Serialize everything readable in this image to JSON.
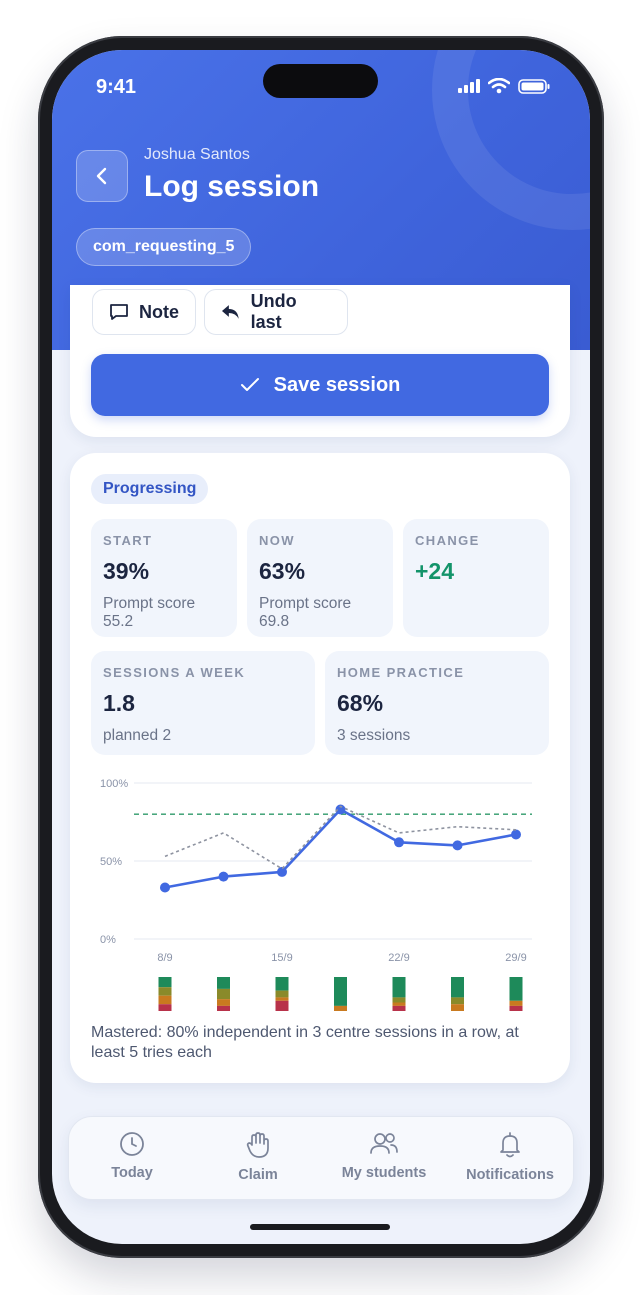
{
  "status_bar": {
    "time": "9:41"
  },
  "header": {
    "student_name": "Joshua Santos",
    "title": "Log session",
    "target_chip": "com_requesting_5"
  },
  "actions": {
    "note_label": "Note",
    "undo_label": "Undo last",
    "save_label": "Save session"
  },
  "progress": {
    "badge": "Progressing",
    "start": {
      "label": "START",
      "value": "39%",
      "sub1": "Prompt score",
      "sub2": "55.2"
    },
    "now": {
      "label": "NOW",
      "value": "63%",
      "sub1": "Prompt score",
      "sub2": "69.8"
    },
    "change": {
      "label": "CHANGE",
      "value": "+24"
    },
    "sessions": {
      "label": "SESSIONS A WEEK",
      "value": "1.8",
      "sub": "planned 2"
    },
    "home": {
      "label": "HOME PRACTICE",
      "value": "68%",
      "sub": "3 sessions"
    },
    "mastery_note": "Mastered: 80% independent in 3 centre sessions in a row, at least 5 tries each"
  },
  "chart_data": {
    "type": "line",
    "y_ticks": [
      "100%",
      "50%",
      "0%"
    ],
    "ylim": [
      0,
      100
    ],
    "x_ticks": [
      "8/9",
      "15/9",
      "22/9",
      "29/9"
    ],
    "target_line": 80,
    "series": [
      {
        "style": "solid",
        "color": "#4169e1",
        "values": [
          33,
          40,
          43,
          83,
          62,
          60,
          67
        ]
      },
      {
        "style": "dotted",
        "color": "#8e93a0",
        "values": [
          53,
          68,
          45,
          85,
          68,
          72,
          70
        ]
      }
    ],
    "session_bars": [
      {
        "green": 0.3,
        "olive": 0.25,
        "orange": 0.25,
        "red": 0.2
      },
      {
        "green": 0.35,
        "olive": 0.3,
        "orange": 0.2,
        "red": 0.15
      },
      {
        "green": 0.4,
        "olive": 0.2,
        "orange": 0.1,
        "red": 0.3
      },
      {
        "green": 0.85,
        "olive": 0.0,
        "orange": 0.15,
        "red": 0.0
      },
      {
        "green": 0.6,
        "olive": 0.15,
        "orange": 0.1,
        "red": 0.15
      },
      {
        "green": 0.6,
        "olive": 0.2,
        "orange": 0.2,
        "red": 0.0
      },
      {
        "green": 0.7,
        "olive": 0.0,
        "orange": 0.15,
        "red": 0.15
      }
    ],
    "colors": {
      "green": "#1e8a5a",
      "olive": "#8a8a2a",
      "orange": "#c97a1f",
      "red": "#b8324a",
      "target": "#2e9a6a"
    }
  },
  "nav": {
    "items": [
      {
        "label": "Today",
        "icon": "clock-icon"
      },
      {
        "label": "Claim",
        "icon": "hand-icon"
      },
      {
        "label": "My students",
        "icon": "users-icon"
      },
      {
        "label": "Notifications",
        "icon": "bell-icon"
      }
    ]
  }
}
